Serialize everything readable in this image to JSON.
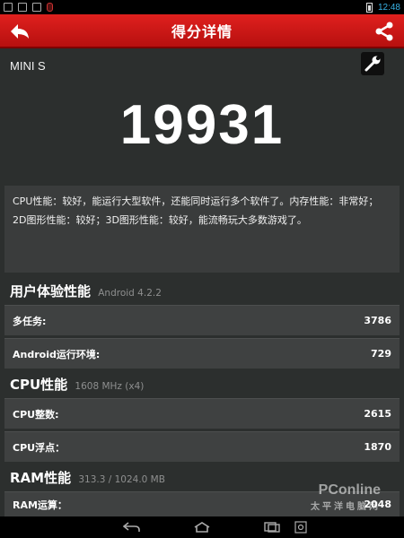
{
  "status_bar": {
    "time": "12:48"
  },
  "header": {
    "title": "得分详情",
    "icons": {
      "back": "back-arrow-icon",
      "share": "share-icon"
    }
  },
  "device": {
    "name": "MINI S",
    "tool_icon": "wrench-icon"
  },
  "score": "19931",
  "summary": "CPU性能：较好，能运行大型软件，还能同时运行多个软件了。内存性能：非常好；2D图形性能：较好；3D图形性能：较好，能流畅玩大多数游戏了。",
  "sections": [
    {
      "title": "用户体验性能",
      "subtitle": "Android 4.2.2",
      "rows": [
        {
          "label": "多任务:",
          "value": "3786"
        },
        {
          "label": "Android运行环境:",
          "value": "729"
        }
      ]
    },
    {
      "title": "CPU性能",
      "subtitle": "1608 MHz (x4)",
      "rows": [
        {
          "label": "CPU整数:",
          "value": "2615"
        },
        {
          "label": "CPU浮点：",
          "value": "1870"
        }
      ]
    },
    {
      "title": "RAM性能",
      "subtitle": "313.3 / 1024.0 MB",
      "rows": [
        {
          "label": "RAM运算：",
          "value": "2048"
        }
      ]
    }
  ],
  "watermark": {
    "line1": "PConline",
    "line2": "太平洋电脑网"
  },
  "colors": {
    "header_red": "#d81b1a",
    "background": "#2c2f2e",
    "row_background": "#3f4141",
    "clock_blue": "#39b3e6"
  }
}
